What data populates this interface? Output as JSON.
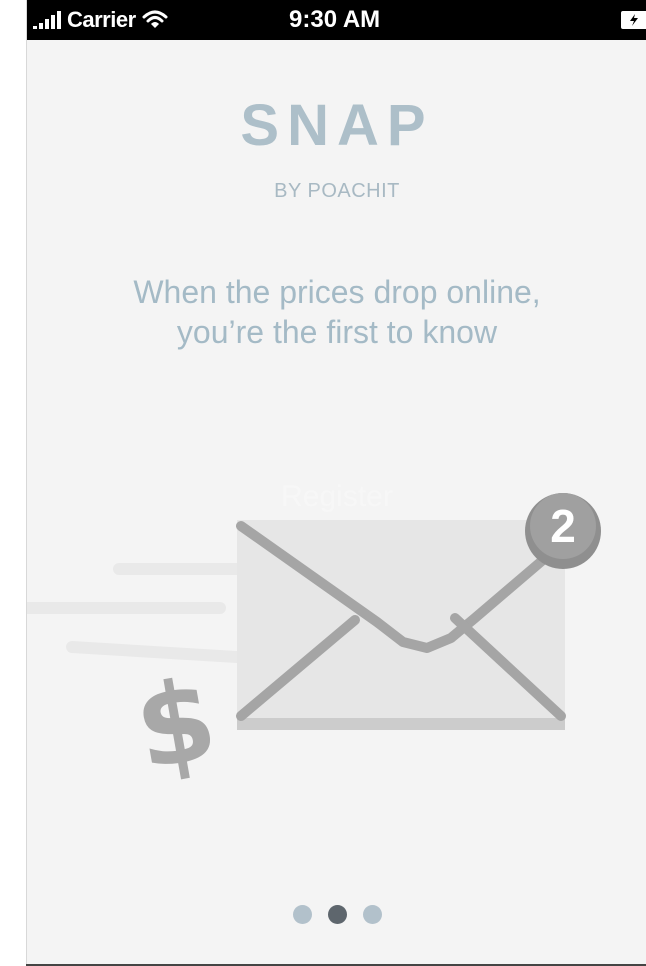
{
  "status_bar": {
    "carrier": "Carrier",
    "time": "9:30 AM",
    "icons": [
      "signal-icon",
      "wifi-icon",
      "battery-charging-icon"
    ]
  },
  "app": {
    "logo": "SNAP",
    "byline": "BY POACHIT",
    "tagline_line1": "When the prices drop online,",
    "tagline_line2": "you’re the first to know",
    "register_label": "Register"
  },
  "illustration": {
    "badge_count": "2",
    "currency_symbol": "$",
    "icons": [
      "envelope-icon",
      "notification-badge",
      "dollar-icon",
      "speed-lines"
    ]
  },
  "pagination": {
    "pages": 3,
    "active_index": 1
  },
  "colors": {
    "background": "#f4f4f4",
    "logo": "#adbfc9",
    "tagline": "#a4bac6",
    "envelope": "#e7e7e7",
    "envelope_lines": "#a6a6a6",
    "badge": "#8f8f8f",
    "dot_inactive": "#b2c1cb",
    "dot_active": "#5e666d"
  }
}
